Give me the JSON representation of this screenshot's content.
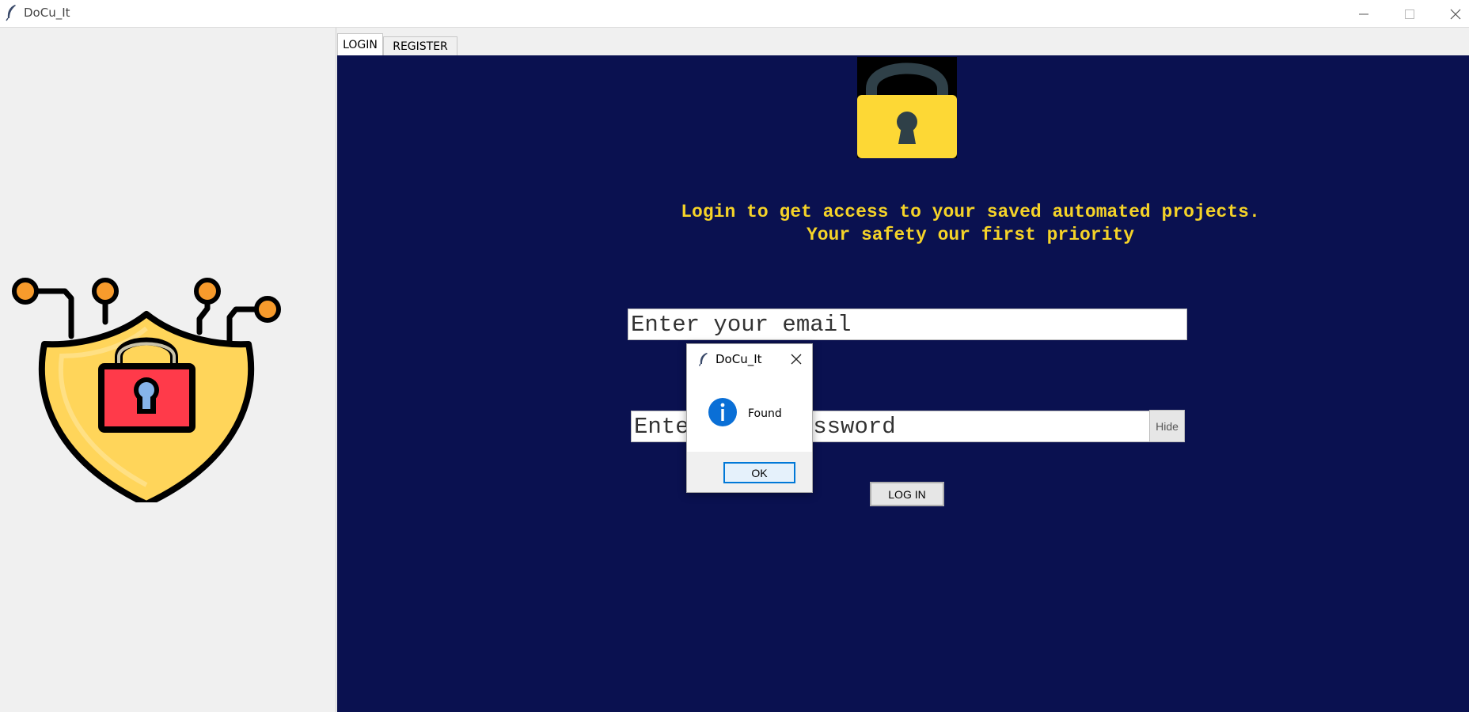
{
  "window": {
    "title": "DoCu_It",
    "app_icon": "feather-icon",
    "controls": [
      "minimize-icon",
      "maximize-icon",
      "close-icon"
    ]
  },
  "left_pane": {
    "image": "shield-lock-circuit-icon",
    "colors": {
      "shield": "#ffd55a",
      "lock": "#ff3a4a",
      "nodes": "#f79b2c",
      "outline": "#000000"
    }
  },
  "tabs": [
    {
      "label": "LOGIN",
      "active": true
    },
    {
      "label": "REGISTER",
      "active": false
    }
  ],
  "login_panel": {
    "background": "#0a1150",
    "accent": "#f5d328",
    "lock_image": "padlock-icon",
    "headline": "Login to get access to your saved automated projects.\nYour safety our first priority",
    "email": {
      "placeholder": "Enter your email"
    },
    "password": {
      "placeholder": "Enter your password"
    },
    "hide_label": "Hide",
    "login_label": "LOG IN"
  },
  "dialog": {
    "title": "DoCu_It",
    "title_icon": "feather-icon",
    "message_icon": "info-icon",
    "message": "Found",
    "ok_label": "OK"
  }
}
